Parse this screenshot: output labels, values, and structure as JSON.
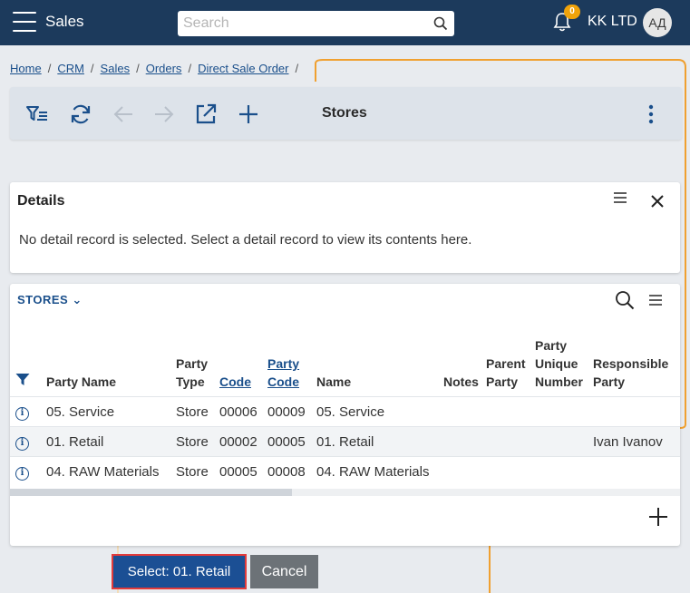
{
  "header": {
    "app_title": "Sales",
    "search_placeholder": "Search",
    "notification_count": "0",
    "company": "KK LTD",
    "avatar_initials": "АД",
    "icons": [
      "menu-icon",
      "search-icon",
      "bell-icon"
    ]
  },
  "breadcrumb": {
    "items": [
      "Home",
      "CRM",
      "Sales",
      "Orders",
      "Direct Sale Order"
    ],
    "separator": "/"
  },
  "toolbar": {
    "title": "Stores",
    "icons": [
      "filter-list-icon",
      "refresh-icon",
      "arrow-left-icon",
      "arrow-right-icon",
      "open-external-icon",
      "plus-icon",
      "more-vertical-icon"
    ]
  },
  "details": {
    "title": "Details",
    "message": "No detail record is selected. Select a detail record to view its contents here."
  },
  "stores": {
    "section_label": "STORES ⌄",
    "columns": {
      "party_name": "Party Name",
      "party_type_1": "Party",
      "party_type_2": "Type",
      "code": "Code",
      "party_code_1": "Party",
      "party_code_2": "Code",
      "name": "Name",
      "notes": "Notes",
      "parent_party_1": "Parent",
      "parent_party_2": "Party",
      "unique_number_1": "Party",
      "unique_number_2": "Unique",
      "unique_number_3": "Number",
      "responsible_1": "Responsible",
      "responsible_2": "Party"
    },
    "rows": [
      {
        "party_name": "05. Service",
        "party_type": "Store",
        "code": "00006",
        "party_code": "00009",
        "name": "05. Service",
        "notes": "",
        "parent_party": "",
        "unique_number": "",
        "responsible": ""
      },
      {
        "party_name": "01. Retail",
        "party_type": "Store",
        "code": "00002",
        "party_code": "00005",
        "name": "01. Retail",
        "notes": "",
        "parent_party": "",
        "unique_number": "",
        "responsible": "Ivan Ivanov"
      },
      {
        "party_name": "04. RAW Materials",
        "party_type": "Store",
        "code": "00005",
        "party_code": "00008",
        "name": "04. RAW Materials",
        "notes": "",
        "parent_party": "",
        "unique_number": "",
        "responsible": ""
      }
    ]
  },
  "actions": {
    "select_label": "Select: 01. Retail",
    "cancel_label": "Cancel"
  },
  "colors": {
    "header_bg": "#1c3a5c",
    "accent": "#1a4f8b",
    "badge": "#f0a30a",
    "highlight_border": "#e23b3b",
    "illustration": "#f0a030"
  }
}
